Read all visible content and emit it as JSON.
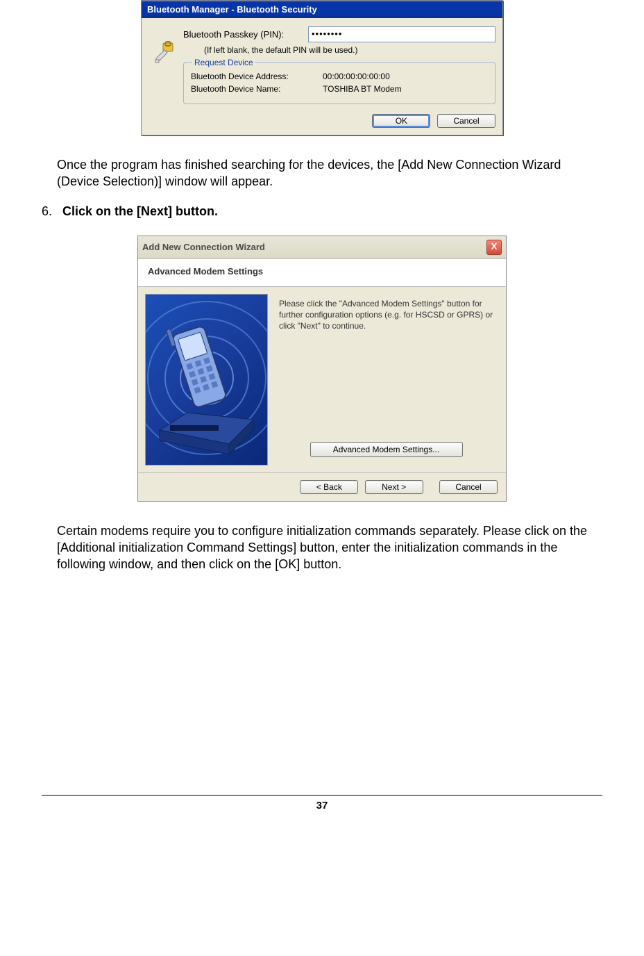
{
  "dialog1": {
    "title": "Bluetooth Manager - Bluetooth Security",
    "passkey_label": "Bluetooth Passkey (PIN):",
    "passkey_value": "••••••••",
    "passkey_hint": "(If left blank, the default PIN will be used.)",
    "group_legend": "Request Device",
    "addr_label": "Bluetooth Device Address:",
    "addr_value": "00:00:00:00:00:00",
    "name_label": "Bluetooth Device Name:",
    "name_value": "TOSHIBA BT Modem",
    "ok": "OK",
    "cancel": "Cancel"
  },
  "para1": "Once the program has finished searching for the devices, the [Add New Connection Wizard (Device Selection)] window will appear.",
  "step": {
    "num": "6.",
    "text": "Click on the [Next] button."
  },
  "dialog2": {
    "title": "Add New Connection Wizard",
    "header": "Advanced Modem Settings",
    "instruction": "Please click the \"Advanced Modem Settings\" button for further configuration options (e.g. for HSCSD or GPRS) or click \"Next\" to continue.",
    "adv_btn": "Advanced Modem Settings...",
    "back": "< Back",
    "next": "Next >",
    "cancel": "Cancel",
    "close_x": "X"
  },
  "para2": "Certain modems require you to configure initialization commands separately. Please click on the [Additional initialization Command Settings] button, enter the initialization commands in the following window, and then click on the [OK] button.",
  "page_number": "37"
}
